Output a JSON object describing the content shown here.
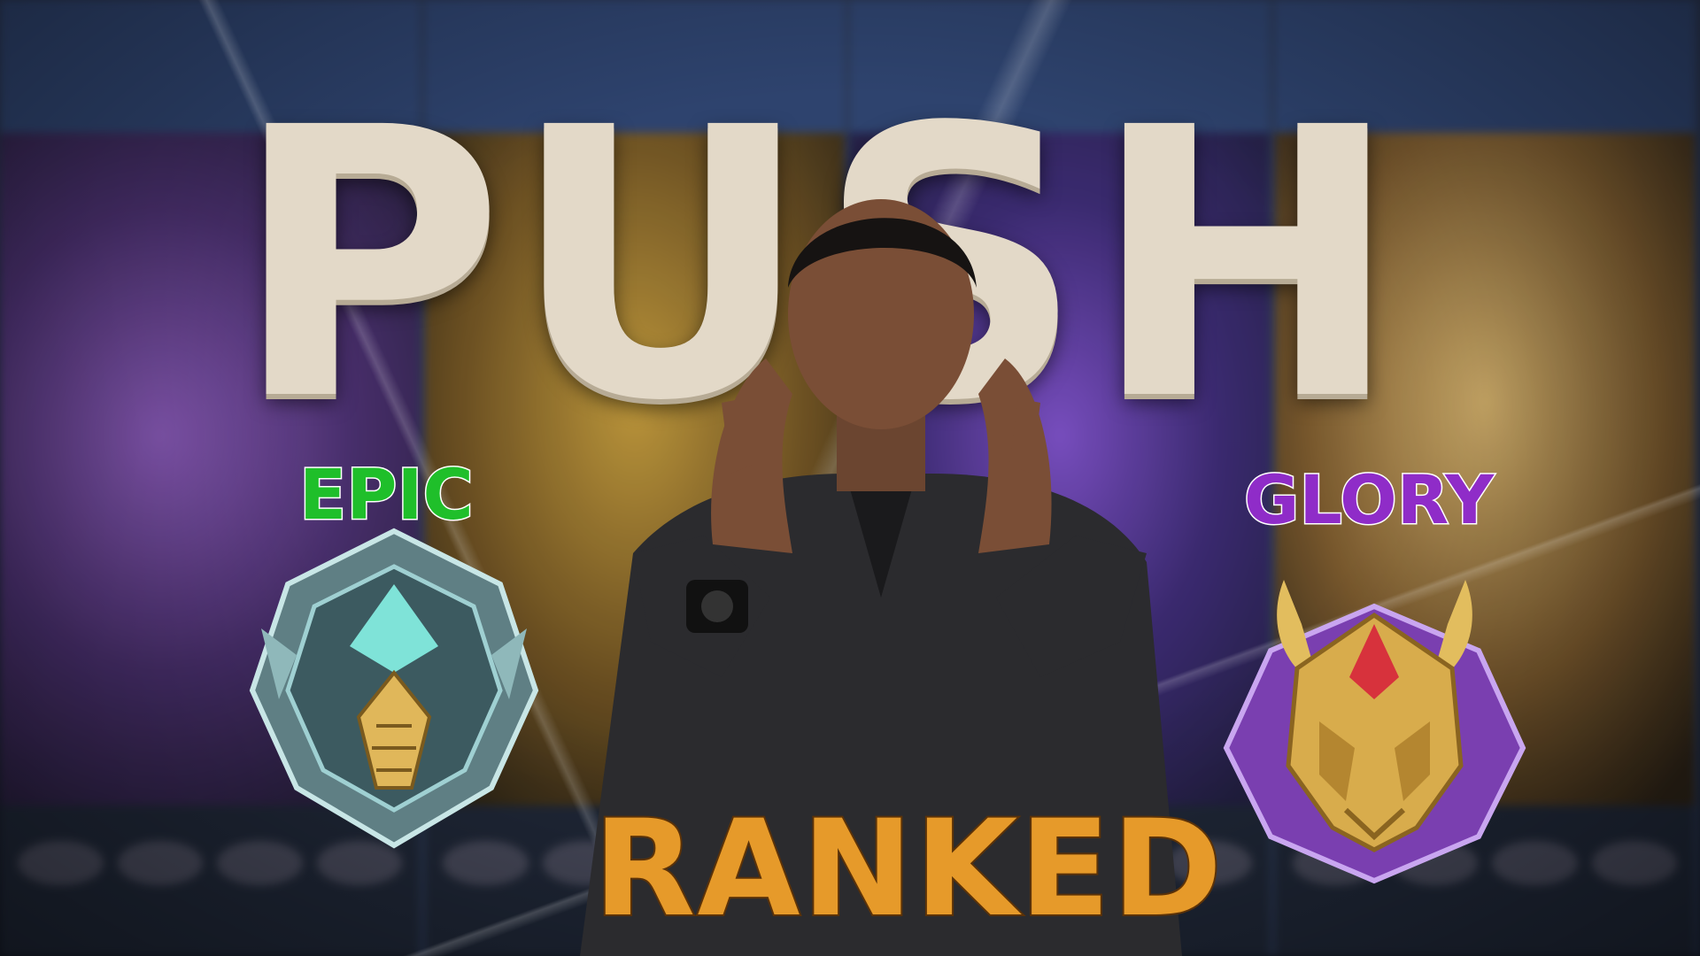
{
  "title": "PUSH",
  "left_rank": {
    "label": "EPIC",
    "color": "#1fbf2a",
    "icon": "epic-rank-badge-icon"
  },
  "right_rank": {
    "label": "GLORY",
    "color": "#8f2cc8",
    "icon": "mythical-glory-rank-badge-icon"
  },
  "subtitle": "RANKED",
  "subtitle_color": "#e69a2a",
  "person": {
    "icon": "person-making-hand-gesture"
  }
}
